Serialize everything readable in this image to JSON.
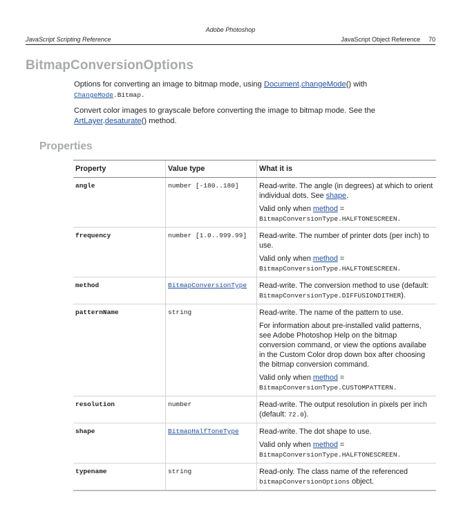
{
  "header": {
    "product": "Adobe Photoshop",
    "left": "JavaScript Scripting Reference",
    "right": "JavaScript Object Reference",
    "page_number": "70"
  },
  "title": "BitmapConversionOptions",
  "intro": {
    "p1": {
      "before": "Options for converting an image to bitmap mode, using ",
      "link1": "Document",
      "dot": ".",
      "link2": "changeMode",
      "after": "() with",
      "link3": "ChangeMode",
      "code": ".Bitmap."
    },
    "p2": {
      "before": "Convert color images to grayscale before converting the image to bitmap mode. See the ",
      "link1": "ArtLayer",
      "dot": ".",
      "link2": "desaturate",
      "after": "() method."
    }
  },
  "properties_heading": "Properties",
  "table": {
    "headers": [
      "Property",
      "Value type",
      "What it is"
    ],
    "rows": [
      {
        "property": "angle",
        "value_type": "number [-180..180]",
        "desc1_before": "Read-write. The angle (in degrees) at which to orient individual dots. See ",
        "desc1_link": "shape",
        "desc1_after": ".",
        "valid_text": "Valid only when ",
        "valid_link": "method",
        "valid_eq": " = ",
        "valid_code": "BitmapConversionType.HALFTONESCREEN."
      },
      {
        "property": "frequency",
        "value_type": "number [1.0..999.99]",
        "desc1": "Read-write. The number of printer dots (per inch) to use.",
        "valid_text": "Valid only when ",
        "valid_link": "method",
        "valid_eq": " = ",
        "valid_code": "BitmapConversionType.HALFTONESCREEN."
      },
      {
        "property": "method",
        "value_type": "BitmapConversionType",
        "desc1": "Read-write. The conversion method to use (default: ",
        "desc1_code": "BitmapConversionType.DIFFUSIONDITHER",
        "desc1_after": ")."
      },
      {
        "property": "patternName",
        "value_type": "string",
        "desc1": "Read-write. The name of the pattern to use.",
        "desc2": "For information about pre-installed valid patterns, see Adobe Photoshop Help on the bitmap conversion command, or view the options availabe in the Custom Color drop down box after choosing the bitmap conversion command.",
        "valid_text": "Valid only when ",
        "valid_link": "method",
        "valid_eq": " = ",
        "valid_code": "BitmapConversionType.CUSTOMPATTERN."
      },
      {
        "property": "resolution",
        "value_type": "number",
        "desc1": "Read-write. The output resolution in pixels per inch (default: ",
        "desc1_code": "72.0",
        "desc1_after": ")."
      },
      {
        "property": "shape",
        "value_type": "BitmapHalfToneType",
        "desc1": "Read-write. The dot shape to use.",
        "valid_text": "Valid only when ",
        "valid_link": "method",
        "valid_eq": " = ",
        "valid_code": "BitmapConversionType.HALFTONESCREEN."
      },
      {
        "property": "typename",
        "value_type": "string",
        "desc1": "Read-only. The class name of the referenced ",
        "desc1_code": "bitmapConversionOptions",
        "desc1_after": " object."
      }
    ]
  }
}
